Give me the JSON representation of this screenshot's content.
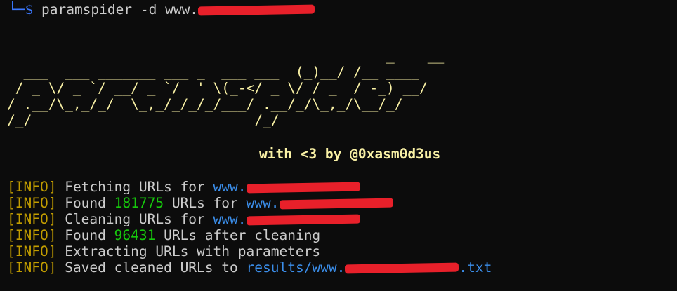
{
  "prompt": {
    "corner": "└─",
    "symbol": "$",
    "command": "paramspider -d www."
  },
  "banner": {
    "ascii_lines": [
      "                                              _    __",
      "  ___  ___ _______ ___ _  ___ ___  (_)__/ /__ ____",
      " / _ \\/ _ `/ __/ _ `/  ' \\(_-</ _ \\/ / _  / -_) __/",
      "/ .__/\\_,_/_/  \\_,_/_/_/_/___/ .__/_/\\_,_/\\__/_/",
      "/_/                           /_/"
    ],
    "credit": "with <3 by @0xasm0d3us"
  },
  "log": {
    "tag": "[INFO]",
    "lines": [
      {
        "text": "Fetching URLs for",
        "url_prefix": "www."
      },
      {
        "pre": "Found",
        "count": "181775",
        "text": "URLs for",
        "url_prefix": "www."
      },
      {
        "text": "Cleaning URLs for",
        "url_prefix": "www."
      },
      {
        "pre": "Found",
        "count": "96431",
        "text": "URLs after cleaning"
      },
      {
        "text": "Extracting URLs with parameters"
      },
      {
        "text": "Saved cleaned URLs to",
        "url_prefix": "results/www.",
        "url_suffix": ".txt"
      }
    ]
  },
  "colors": {
    "background": "#0c0c0c",
    "banner": "#f9f1a5",
    "info_tag": "#c19c00",
    "count": "#16c60c",
    "url": "#3b8eea",
    "redaction": "#e8202a"
  }
}
